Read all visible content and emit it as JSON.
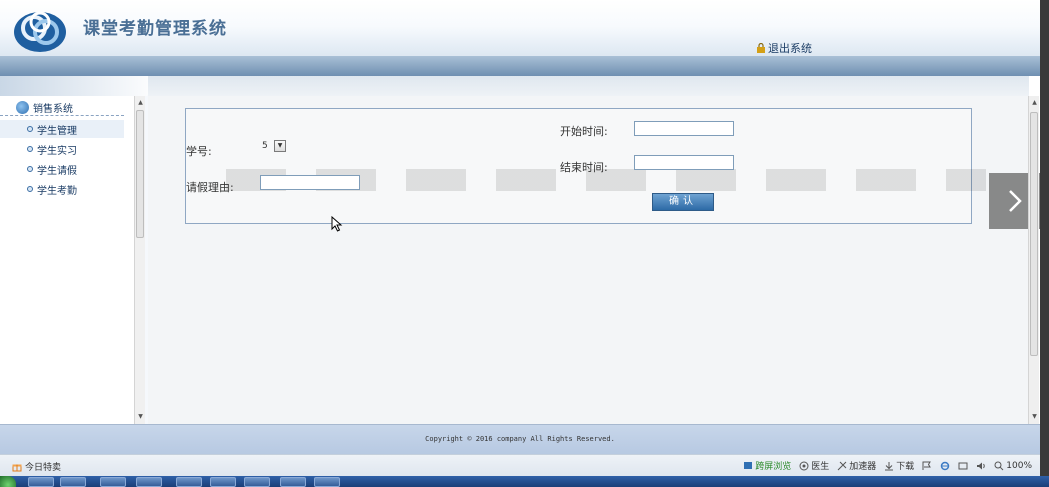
{
  "app": {
    "title": "课堂考勤管理系统",
    "logout_label": "退出系统"
  },
  "sidebar": {
    "section_title": "销售系统",
    "items": [
      {
        "label": "学生管理",
        "active": true
      },
      {
        "label": "学生实习",
        "active": false
      },
      {
        "label": "学生请假",
        "active": false
      },
      {
        "label": "学生考勤",
        "active": false
      }
    ]
  },
  "form": {
    "student_id_label": "学号:",
    "student_id_value": "5",
    "reason_label": "请假理由:",
    "reason_value": "",
    "start_time_label": "开始时间:",
    "start_time_value": "",
    "end_time_label": "结束时间:",
    "end_time_value": "",
    "confirm_label": "确认"
  },
  "footer": {
    "copyright": "Copyright © 2016 company All Rights Reserved."
  },
  "statusbar": {
    "left_label": "今日特卖",
    "items": [
      {
        "label": "跨屏浏览",
        "icon": "screen-icon"
      },
      {
        "label": "医生",
        "icon": "doctor-icon"
      },
      {
        "label": "加速器",
        "icon": "accelerator-icon"
      },
      {
        "label": "下载",
        "icon": "download-icon"
      }
    ],
    "zoom": "100%"
  },
  "colors": {
    "header_blue": "#4a6f95",
    "footer_bg": "#c7d6ea",
    "panel_border": "#8fa7c3",
    "button_blue": "#2d6aa6"
  }
}
